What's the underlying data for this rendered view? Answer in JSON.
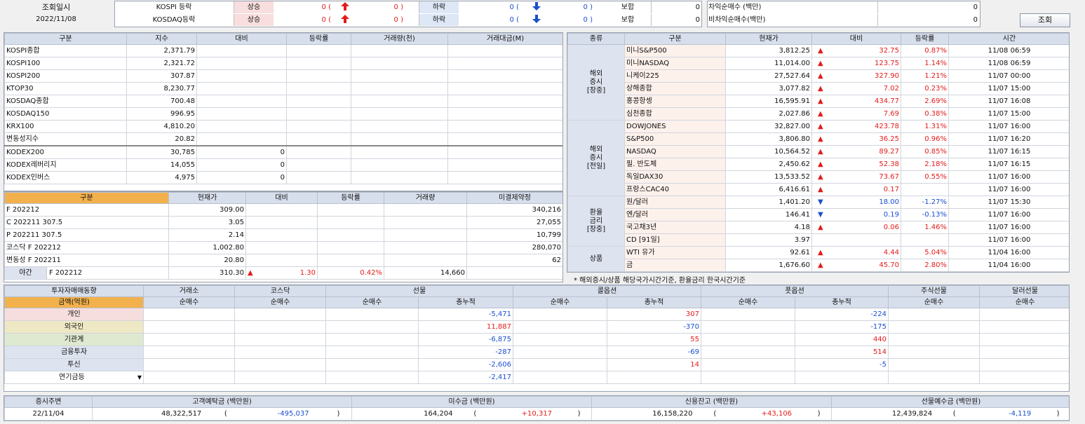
{
  "top": {
    "date_label": "조회일시",
    "date_value": "2022/11/08",
    "rows": [
      {
        "name": "KOSPI 등락",
        "up_label": "상승",
        "up_val": "0 (",
        "up_paren": "0 )",
        "down_label": "하락",
        "down_val": "0 (",
        "down_paren": "0 )",
        "flat_label": "보합",
        "flat_val": "0"
      },
      {
        "name": "KOSDAQ등락",
        "up_label": "상승",
        "up_val": "0 (",
        "up_paren": "0 )",
        "down_label": "하락",
        "down_val": "0 (",
        "down_paren": "0 )",
        "flat_label": "보합",
        "flat_val": "0"
      }
    ],
    "arb": [
      {
        "label": "차익순매수  (백만)",
        "val": "0"
      },
      {
        "label": "비차익순매수(백만)",
        "val": "0"
      }
    ],
    "query_btn": "조회"
  },
  "index": {
    "headers": [
      "구분",
      "지수",
      "대비",
      "등락률",
      "거래량(천)",
      "거래대금(M)"
    ],
    "rows": [
      [
        "KOSPI종합",
        "2,371.79"
      ],
      [
        "KOSPI100",
        "2,321.72"
      ],
      [
        "KOSPI200",
        "307.87"
      ],
      [
        "KTOP30",
        "8,230.77"
      ],
      [
        "KOSDAQ종합",
        "700.48"
      ],
      [
        "KOSDAQ150",
        "996.95"
      ],
      [
        "KRX100",
        "4,810.20"
      ],
      [
        "변동성지수",
        "20.82"
      ]
    ],
    "etf": [
      [
        "KODEX200",
        "30,785",
        "0"
      ],
      [
        "KODEX레버리지",
        "14,055",
        "0"
      ],
      [
        "KODEX인버스",
        "4,975",
        "0"
      ]
    ]
  },
  "fut": {
    "headers": [
      "구분",
      "현재가",
      "대비",
      "등락률",
      "거래량",
      "미결제약정"
    ],
    "rows": [
      [
        "F 202212",
        "309.00",
        "340,216"
      ],
      [
        "C 202211 307.5",
        "3.05",
        "27,055"
      ],
      [
        "P 202211 307.5",
        "2.14",
        "10,799"
      ],
      [
        "코스닥 F 202212",
        "1,002.80",
        "280,070"
      ],
      [
        "변동성 F 202211",
        "20.80",
        "62"
      ]
    ],
    "night": {
      "label": "야간",
      "code": "F 202212",
      "price": "310.30",
      "chg": "1.30",
      "rate": "0.42%",
      "vol": "14,660"
    }
  },
  "world": {
    "headers": [
      "종류",
      "구분",
      "현재가",
      "대비",
      "등락률",
      "시간"
    ],
    "groups": [
      {
        "label": "해외\n증시\n[장중]",
        "rows": [
          {
            "name": "미니S&P500",
            "price": "3,812.25",
            "dir": "up",
            "chg": "32.75",
            "rate": "0.87%",
            "time": "11/08 06:59"
          },
          {
            "name": "미니NASDAQ",
            "price": "11,014.00",
            "dir": "up",
            "chg": "123.75",
            "rate": "1.14%",
            "time": "11/08 06:59"
          },
          {
            "name": "니케이225",
            "price": "27,527.64",
            "dir": "up",
            "chg": "327.90",
            "rate": "1.21%",
            "time": "11/07 00:00"
          },
          {
            "name": "상해종합",
            "price": "3,077.82",
            "dir": "up",
            "chg": "7.02",
            "rate": "0.23%",
            "time": "11/07 15:00"
          },
          {
            "name": "홍콩항셍",
            "price": "16,595.91",
            "dir": "up",
            "chg": "434.77",
            "rate": "2.69%",
            "time": "11/07 16:08"
          },
          {
            "name": "심천종합",
            "price": "2,027.86",
            "dir": "up",
            "chg": "7.69",
            "rate": "0.38%",
            "time": "11/07 15:00"
          }
        ]
      },
      {
        "label": "해외\n증시\n[전일]",
        "rows": [
          {
            "name": "DOWJONES",
            "price": "32,827.00",
            "dir": "up",
            "chg": "423.78",
            "rate": "1.31%",
            "time": "11/07 16:00"
          },
          {
            "name": "S&P500",
            "price": "3,806.80",
            "dir": "up",
            "chg": "36.25",
            "rate": "0.96%",
            "time": "11/07 16:20"
          },
          {
            "name": "NASDAQ",
            "price": "10,564.52",
            "dir": "up",
            "chg": "89.27",
            "rate": "0.85%",
            "time": "11/07 16:15"
          },
          {
            "name": "필. 반도체",
            "price": "2,450.62",
            "dir": "up",
            "chg": "52.38",
            "rate": "2.18%",
            "time": "11/07 16:15"
          },
          {
            "name": "독일DAX30",
            "price": "13,533.52",
            "dir": "up",
            "chg": "73.67",
            "rate": "0.55%",
            "time": "11/07 16:00"
          },
          {
            "name": "프랑스CAC40",
            "price": "6,416.61",
            "dir": "up",
            "chg": "0.17",
            "rate": "",
            "time": "11/07 16:00"
          }
        ]
      },
      {
        "label": "환율\n금리\n[장중]",
        "rows": [
          {
            "name": "원/달러",
            "price": "1,401.20",
            "dir": "dn",
            "chg": "18.00",
            "rate": "-1.27%",
            "time": "11/07 15:30"
          },
          {
            "name": "엔/달러",
            "price": "146.41",
            "dir": "dn",
            "chg": "0.19",
            "rate": "-0.13%",
            "time": "11/07 16:00"
          },
          {
            "name": "국고채3년",
            "price": "4.18",
            "dir": "up",
            "chg": "0.06",
            "rate": "1.46%",
            "time": "11/07 16:00"
          },
          {
            "name": "CD [91일]",
            "price": "3.97",
            "dir": "",
            "chg": "",
            "rate": "",
            "time": "11/07 16:00"
          }
        ]
      },
      {
        "label": "상품",
        "rows": [
          {
            "name": "WTI 유가",
            "price": "92.61",
            "dir": "up",
            "chg": "4.44",
            "rate": "5.04%",
            "time": "11/04 16:00"
          },
          {
            "name": "금",
            "price": "1,676.60",
            "dir": "up",
            "chg": "45.70",
            "rate": "2.80%",
            "time": "11/04 16:00"
          }
        ]
      }
    ],
    "note": "* 해외증시/상품 해당국가시간기준, 환율금리 한국시간기준"
  },
  "investor": {
    "title": "투자자매매동향",
    "amount": "금액(억원)",
    "cols": [
      "거래소",
      "코스닥",
      "선물",
      "콜옵션",
      "풋옵션",
      "주식선물",
      "달러선물"
    ],
    "sub": [
      "순매수",
      "순매수",
      "순매수",
      "총누적",
      "순매수",
      "총누적",
      "순매수",
      "총누적",
      "순매수",
      "순매수"
    ],
    "rows": [
      {
        "name": "개인",
        "bg": "#f7dede",
        "fut_tot": "-5,471",
        "call_tot": "307",
        "put_tot": "-224"
      },
      {
        "name": "외국인",
        "bg": "#efe8c4",
        "fut_tot": "11,887",
        "call_tot": "-370",
        "put_tot": "-175"
      },
      {
        "name": "기관계",
        "bg": "#dfe9cf",
        "fut_tot": "-6,875",
        "call_tot": "55",
        "put_tot": "440"
      },
      {
        "name": "금융투자",
        "bg": "#dde3ef",
        "fut_tot": "-287",
        "call_tot": "-69",
        "put_tot": "514"
      },
      {
        "name": "투신",
        "bg": "#dde3ef",
        "fut_tot": "-2,606",
        "call_tot": "14",
        "put_tot": "-5"
      },
      {
        "name": "연기금등",
        "bg": "#ffffff",
        "fut_tot": "-2,417",
        "call_tot": "",
        "put_tot": ""
      }
    ]
  },
  "bottom": {
    "headers": [
      "증시주변",
      "고객예탁금 (백만원)",
      "미수금 (백만원)",
      "신용잔고 (백만원)",
      "선물예수금 (백만원)"
    ],
    "date": "22/11/04",
    "vals": [
      {
        "v": "48,322,517",
        "c": "-495,037"
      },
      {
        "v": "164,204",
        "c": "+10,317"
      },
      {
        "v": "16,158,220",
        "c": "+43,106"
      },
      {
        "v": "12,439,824",
        "c": "-4,119"
      }
    ]
  }
}
